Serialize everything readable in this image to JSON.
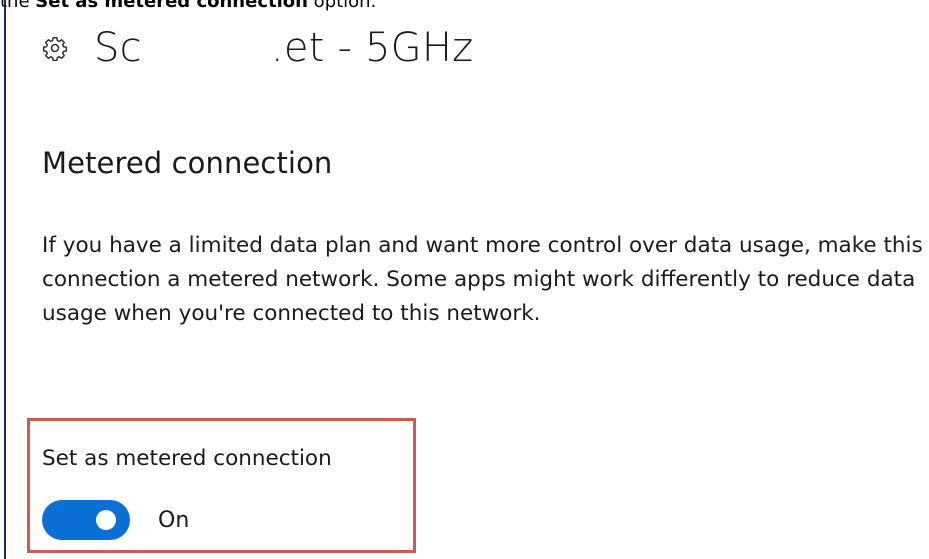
{
  "caption": {
    "before": "the ",
    "bold": "Set as metered connection",
    "after": " option."
  },
  "header": {
    "icon": "gear-icon",
    "title": "Sc          .et - 5GHz"
  },
  "metered": {
    "section_title": "Metered connection",
    "description": "If you have a limited data plan and want more control over data usage, make this connection a metered network. Some apps might work differently to reduce data usage when you're connected to this network.",
    "toggle_label": "Set as metered connection",
    "toggle_state": "On",
    "toggle_on": true
  },
  "colors": {
    "accent": "#0a6fd6",
    "highlight_border": "#cf5a55"
  }
}
